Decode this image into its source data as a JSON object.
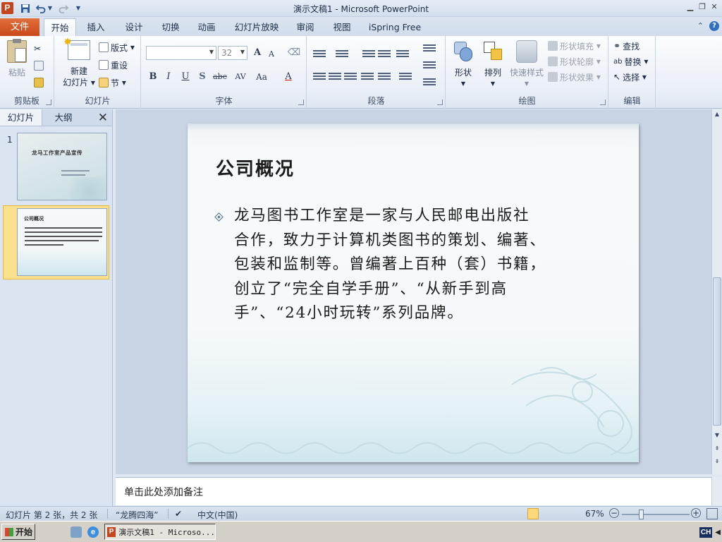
{
  "window": {
    "title": "演示文稿1 - Microsoft PowerPoint",
    "app_icon": "P",
    "qat": {
      "save_icon": "save-icon",
      "undo_icon": "undo-icon",
      "redo_icon": "redo-icon"
    }
  },
  "tabs": [
    "文件",
    "开始",
    "插入",
    "设计",
    "切换",
    "动画",
    "幻灯片放映",
    "审阅",
    "视图",
    "iSpring Free"
  ],
  "active_tab": "开始",
  "ribbon": {
    "clipboard": {
      "label": "剪贴板",
      "paste": "粘贴"
    },
    "slides": {
      "label": "幻灯片",
      "new_slide_1": "新建",
      "new_slide_2": "幻灯片",
      "layout": "版式",
      "reset": "重设",
      "section": "节"
    },
    "font": {
      "label": "字体",
      "font_name": "",
      "font_size": "32",
      "bold": "B",
      "italic": "I",
      "underline": "U",
      "shadow": "S",
      "strike": "abc",
      "spacing": "AV",
      "case": "Aa",
      "color": "A",
      "grow": "A",
      "shrink": "A"
    },
    "paragraph": {
      "label": "段落"
    },
    "drawing": {
      "label": "绘图",
      "shapes": "形状",
      "arrange": "排列",
      "quick_styles": "快速样式",
      "fill": "形状填充",
      "outline": "形状轮廓",
      "effects": "形状效果"
    },
    "editing": {
      "label": "编辑",
      "find": "查找",
      "replace": "替换",
      "select": "选择"
    }
  },
  "left_pane": {
    "tabs": [
      "幻灯片",
      "大纲"
    ],
    "thumbs": [
      {
        "number": "1",
        "title": "龙马工作室产品宣传"
      },
      {
        "number": "2",
        "title": "公司概况"
      }
    ]
  },
  "slide": {
    "title": "公司概况",
    "body": "龙马图书工作室是一家与人民邮电出版社合作，致力于计算机类图书的策划、编著、包装和监制等。曾编著上百种（套）书籍，创立了“完全自学手册”、“从新手到高手”、“24小时玩转”系列品牌。",
    "body_lines": [
      "龙马图书工作室是一家与人民邮电出版社",
      "合作，致力于计算机类图书的策划、编著、",
      "包装和监制等。曾编著上百种（套）书籍，",
      "创立了“完全自学手册”、“从新手到高",
      "手”、“24小时玩转”系列品牌。"
    ]
  },
  "notes": {
    "placeholder": "单击此处添加备注"
  },
  "status": {
    "slide_info": "幻灯片 第 2 张，共 2 张",
    "theme": "“龙腾四海”",
    "language": "中文(中国)",
    "zoom": "67%"
  },
  "taskbar": {
    "start": "开始",
    "task": "演示文稿1 - Microso...",
    "ime": "CH"
  },
  "colors": {
    "file_tab": "#d0531f",
    "ribbon_bg": "#e8eef6",
    "selected_thumb": "#fbe18e"
  }
}
